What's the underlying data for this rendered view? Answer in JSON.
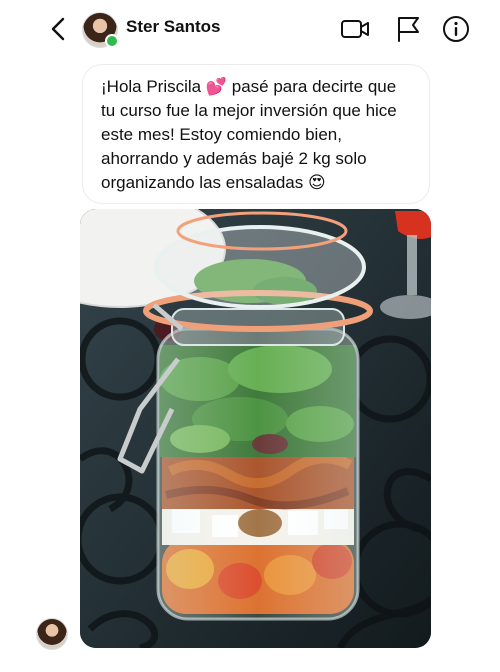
{
  "header": {
    "contact_name": "Ster Santos",
    "back_icon": "chevron-left-icon",
    "video_icon": "video-camera-icon",
    "flag_icon": "flag-icon",
    "info_icon": "info-icon",
    "online_color": "#2fbb4f"
  },
  "message": {
    "lines": [
      "¡Hola Priscila 💕 pasé para decirte que",
      "tu curso fue la mejor inversión que hice",
      "este mes! Estoy comiendo bien,",
      "ahorrando y además bajé 2 kg solo",
      "organizando las ensaladas 😍"
    ]
  },
  "photo": {
    "subject": "salad-jar-photo"
  }
}
